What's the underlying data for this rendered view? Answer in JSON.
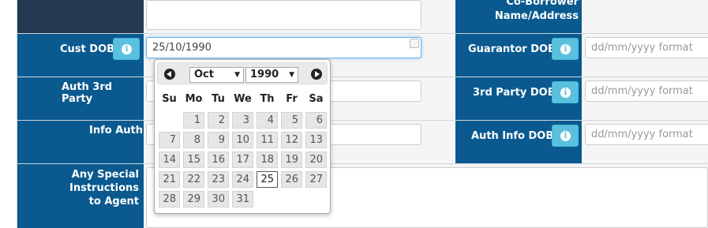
{
  "rows": {
    "co_borrower_label": "Co-Borrower Name/Address",
    "co_borrower_line1": "Co-Borrower",
    "co_borrower_line2": "Name/Address",
    "cust_dob_label": "Cust DOB",
    "cust_dob_value": "25/10/1990",
    "auth_3rd_party_label": "Auth 3rd Party",
    "info_auth_label": "Info Auth",
    "special_line1": "Any Special",
    "special_line2": "Instructions",
    "special_line3": "to Agent",
    "guarantor_dob_label": "Guarantor DOB",
    "third_party_dob_label": "3rd Party DOB",
    "auth_info_dob_label": "Auth Info DOB",
    "date_placeholder": "dd/mm/yyyy format",
    "info_glyph": "i"
  },
  "colors": {
    "label_bg": "#0a5a8f",
    "label_dark_bg": "#233a50",
    "info_btn": "#5bc0de"
  },
  "datepicker": {
    "month": "Oct",
    "year": "1990",
    "arrow": "▼",
    "weekdays": [
      "Su",
      "Mo",
      "Tu",
      "We",
      "Th",
      "Fr",
      "Sa"
    ],
    "weeks": [
      [
        "",
        "1",
        "2",
        "3",
        "4",
        "5",
        "6"
      ],
      [
        "7",
        "8",
        "9",
        "10",
        "11",
        "12",
        "13"
      ],
      [
        "14",
        "15",
        "16",
        "17",
        "18",
        "19",
        "20"
      ],
      [
        "21",
        "22",
        "23",
        "24",
        "25",
        "26",
        "27"
      ],
      [
        "28",
        "29",
        "30",
        "31",
        "",
        "",
        ""
      ]
    ],
    "selected_day": "25"
  }
}
